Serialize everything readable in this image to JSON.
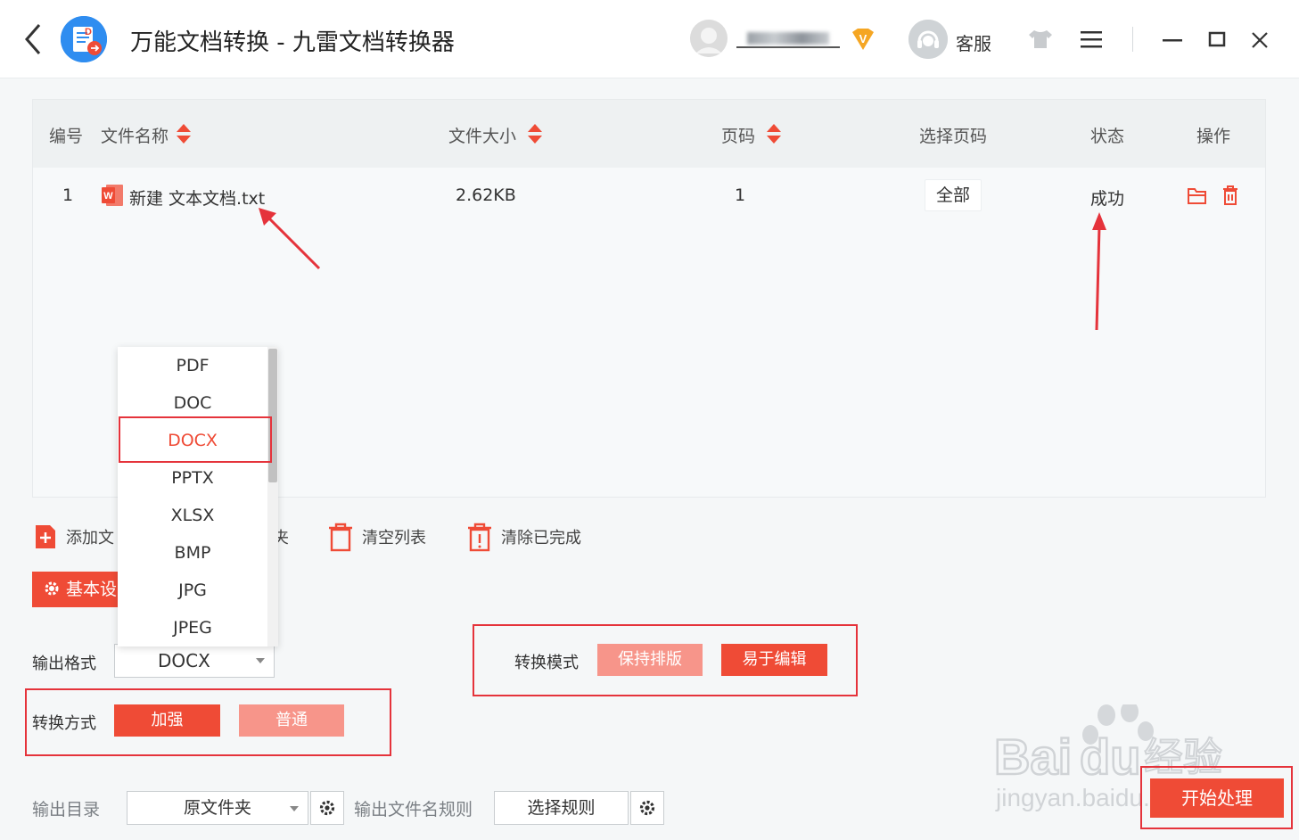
{
  "titlebar": {
    "title": "万能文档转换 - 九雷文档转换器",
    "service_label": "客服",
    "vip_badge": "V"
  },
  "table": {
    "headers": {
      "index": "编号",
      "name": "文件名称",
      "size": "文件大小",
      "pages": "页码",
      "page_select": "选择页码",
      "status": "状态",
      "actions": "操作"
    },
    "rows": [
      {
        "index": "1",
        "name": "新建 文本文档.txt",
        "size": "2.62KB",
        "pages": "1",
        "page_select": "全部",
        "status": "成功"
      }
    ]
  },
  "toolbar": {
    "add_file": "添加文",
    "add_folder_tail": "夹",
    "clear_list": "清空列表",
    "clear_done": "清除已完成"
  },
  "settings": {
    "basic_tab": "基本设",
    "output_format_label": "输出格式",
    "output_format_value": "DOCX",
    "conversion_method_label": "转换方式",
    "method_enhanced": "加强",
    "method_normal": "普通",
    "conversion_mode_label": "转换模式",
    "mode_keep_layout": "保持排版",
    "mode_easy_edit": "易于编辑",
    "output_dir_label": "输出目录",
    "output_dir_value": "原文件夹",
    "filename_rule_label": "输出文件名规则",
    "filename_rule_value": "选择规则",
    "start_button": "开始处理"
  },
  "dropdown": {
    "options": [
      "PDF",
      "DOC",
      "DOCX",
      "PPTX",
      "XLSX",
      "BMP",
      "JPG",
      "JPEG"
    ],
    "selected": "DOCX"
  },
  "watermark": {
    "brand": "Bai",
    "brand2": "du",
    "cn": "经验",
    "url": "jingyan.baidu.com"
  },
  "colors": {
    "accent": "#ef4b36",
    "accent_light": "#f7958a",
    "annotation": "#e5333b"
  }
}
